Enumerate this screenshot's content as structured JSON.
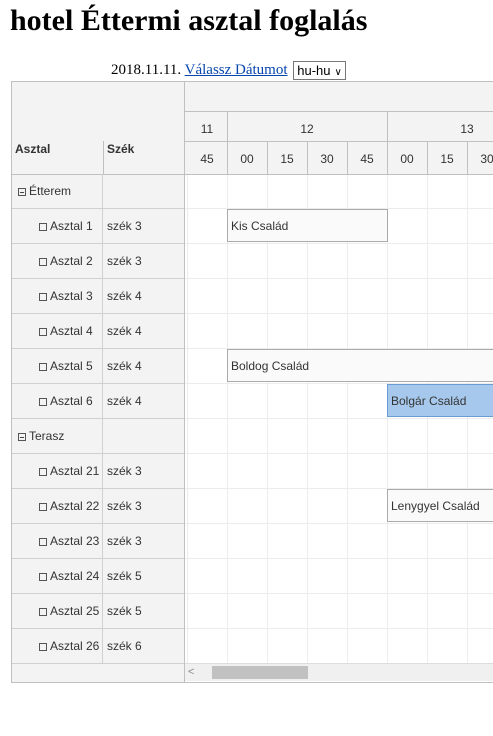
{
  "page": {
    "title": "hotel Éttermi asztal foglalás"
  },
  "toolbar": {
    "date": "2018.11.11.",
    "choose_date_link": "Válassz Dátumot",
    "locale_value": "hu-hu"
  },
  "scheduler": {
    "columns": {
      "table": "Asztal",
      "seat": "Szék"
    },
    "hours": [
      "11",
      "12",
      "13"
    ],
    "minutes": [
      "45",
      "00",
      "15",
      "30",
      "45",
      "00",
      "15",
      "30"
    ],
    "rows": [
      {
        "type": "group",
        "label": "Étterem",
        "seat": ""
      },
      {
        "type": "item",
        "label": "Asztal 1",
        "seat": "szék 3"
      },
      {
        "type": "item",
        "label": "Asztal 2",
        "seat": "szék 3"
      },
      {
        "type": "item",
        "label": "Asztal 3",
        "seat": "szék 4"
      },
      {
        "type": "item",
        "label": "Asztal 4",
        "seat": "szék 4"
      },
      {
        "type": "item",
        "label": "Asztal 5",
        "seat": "szék 4"
      },
      {
        "type": "item",
        "label": "Asztal 6",
        "seat": "szék 4"
      },
      {
        "type": "group",
        "label": "Terasz",
        "seat": ""
      },
      {
        "type": "item",
        "label": "Asztal 21",
        "seat": "szék 3"
      },
      {
        "type": "item",
        "label": "Asztal 22",
        "seat": "szék 3"
      },
      {
        "type": "item",
        "label": "Asztal 23",
        "seat": "szék 3"
      },
      {
        "type": "item",
        "label": "Asztal 24",
        "seat": "szék 5"
      },
      {
        "type": "item",
        "label": "Asztal 25",
        "seat": "szék 5"
      },
      {
        "type": "item",
        "label": "Asztal 26",
        "seat": "szék 6"
      }
    ],
    "events": [
      {
        "label": "Kis Család",
        "row": 1,
        "start": "12:00",
        "end": "13:00",
        "selected": false
      },
      {
        "label": "Boldog Család",
        "row": 5,
        "start": "12:00",
        "end": "13:45",
        "selected": false
      },
      {
        "label": "Bolgár Család",
        "row": 6,
        "start": "13:00",
        "end": "13:45",
        "selected": true
      },
      {
        "label": "Lenygyel Család",
        "row": 9,
        "start": "13:00",
        "end": "13:45",
        "selected": false
      }
    ],
    "colors": {
      "selected_event": "#a6c8ec",
      "header_bg": "#f3f3f3",
      "link": "#0645ad"
    }
  }
}
